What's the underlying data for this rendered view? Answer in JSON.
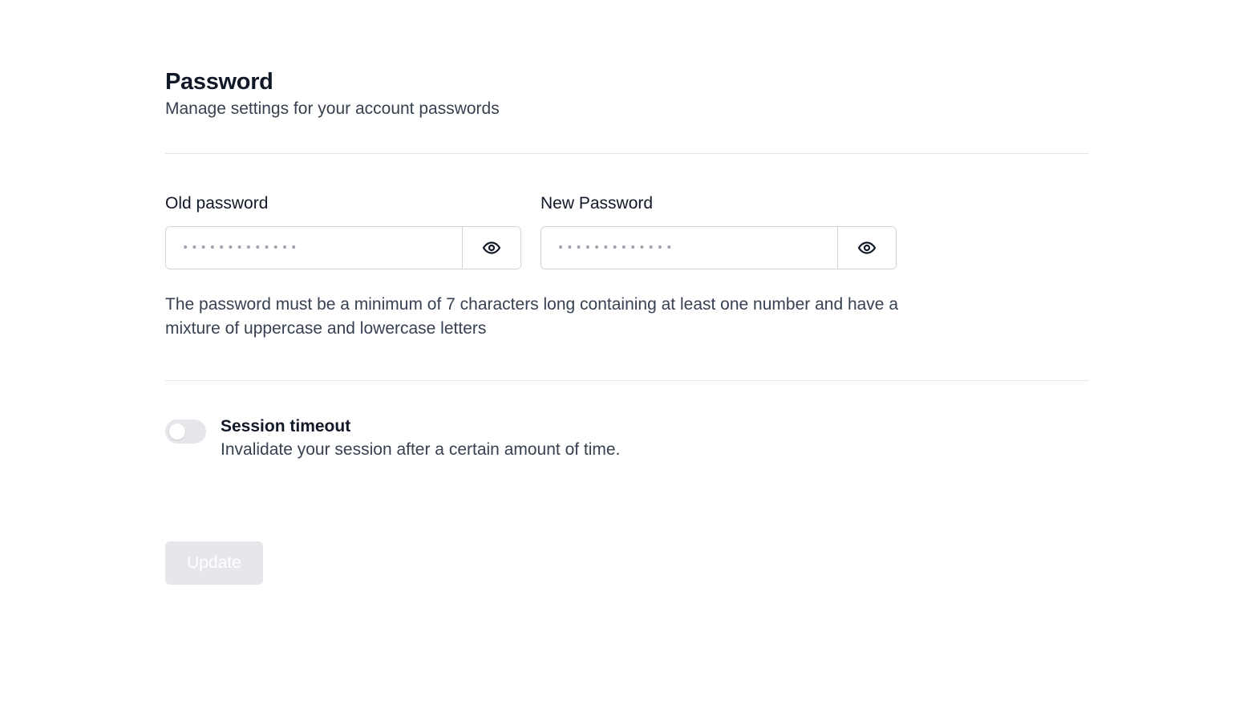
{
  "header": {
    "title": "Password",
    "subtitle": "Manage settings for your account passwords"
  },
  "fields": {
    "old_password": {
      "label": "Old password",
      "placeholder": "•••••••••••••",
      "toggle_icon": "eye-icon"
    },
    "new_password": {
      "label": "New Password",
      "placeholder": "•••••••••••••",
      "toggle_icon": "eye-icon"
    }
  },
  "help_text": "The password must be a minimum of 7 characters long containing at least one number and have a mixture of uppercase and lowercase letters",
  "session_timeout": {
    "title": "Session timeout",
    "description": "Invalidate your session after a certain amount of time.",
    "enabled": false
  },
  "actions": {
    "update_label": "Update",
    "update_disabled": true
  },
  "colors": {
    "text_primary": "#111827",
    "text_secondary": "#374151",
    "border": "#d1d5db",
    "divider": "#e5e7eb",
    "disabled_button_bg": "#e5e7eb",
    "toggle_off_bg": "#e5e7eb"
  }
}
